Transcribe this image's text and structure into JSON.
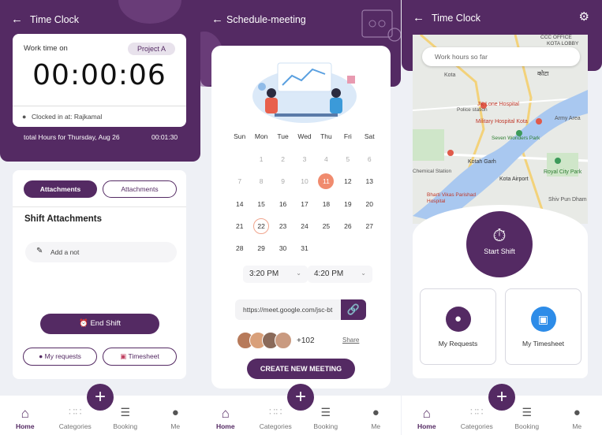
{
  "screen1": {
    "title": "Time Clock",
    "work_time_label": "Work time on",
    "project_badge": "Project A",
    "timer": "00:00:06",
    "clocked_in": "Clocked in at: Rajkamal",
    "total_label": "total Hours for Thursday, Aug 26",
    "total_value": "00:01:30",
    "tab_active": "Attachments",
    "tab_inactive": "Attachments",
    "section_title": "Shift Attachments",
    "note_placeholder": "Add a not",
    "end_shift": "End Shift",
    "my_requests": "My requests",
    "timesheet": "Timesheet"
  },
  "screen2": {
    "title": "Schedule-meeting",
    "weekdays": [
      "Sun",
      "Mon",
      "Tue",
      "Wed",
      "Thu",
      "Fri",
      "Sat"
    ],
    "calendar_rows": [
      [
        "",
        "",
        "",
        "",
        "",
        "",
        ""
      ],
      [
        "",
        "1",
        "2",
        "3",
        "4",
        "5",
        "6"
      ],
      [
        "7",
        "8",
        "9",
        "10",
        "11",
        "12",
        "13"
      ],
      [
        "14",
        "15",
        "16",
        "17",
        "18",
        "19",
        "20"
      ],
      [
        "21",
        "22",
        "23",
        "24",
        "25",
        "26",
        "27"
      ],
      [
        "28",
        "29",
        "30",
        "31",
        "",
        "",
        ""
      ]
    ],
    "selected_day": "11",
    "today_day": "22",
    "time_start": "3:20  PM",
    "time_end": "4:20  PM",
    "meet_link": "https://meet.google.com/jsc-bt",
    "more_count": "+102",
    "share": "Share",
    "create_btn": "CREATE NEW MEETING"
  },
  "screen3": {
    "title": "Time Clock",
    "search_placeholder": "Work hours so far",
    "map_labels": [
      "CCC OFFICE",
      "KOTA LOBBY",
      "Kota",
      "कोटा",
      "Police station",
      "JK Lone Hospital",
      "Military Hospital Kota",
      "Army Area",
      "Seven Wonders Park",
      "Kotah Garh",
      "Kota Airport",
      "Royal City Park",
      "Bharti Vikas Parishad Hospital",
      "Shiv Pun Dham",
      "Chemical Station",
      "Industrial Station",
      "SVAR",
      "Ananpura",
      "P.S. Office K",
      "K",
      "perpur",
      "sadati",
      "ADS",
      "Fi",
      "lat"
    ],
    "start_shift": "Start Shift",
    "my_requests": "My Requests",
    "my_timesheet": "My Timesheet"
  },
  "nav": {
    "home": "Home",
    "categories": "Categories",
    "booking": "Booking",
    "me": "Me",
    "plus": "+"
  },
  "colors": {
    "primary": "#542a63",
    "accent": "#f08b6e"
  }
}
